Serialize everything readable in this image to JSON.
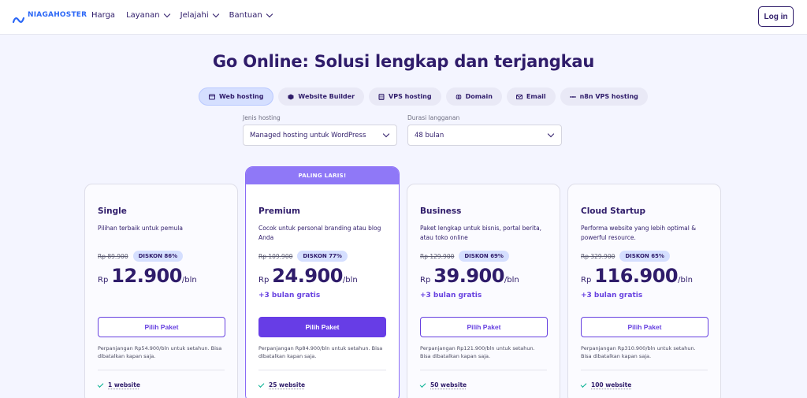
{
  "header": {
    "logo_text": "NIAGAHOSTER",
    "nav": [
      {
        "label": "Harga",
        "has_menu": false
      },
      {
        "label": "Layanan",
        "has_menu": true
      },
      {
        "label": "Jelajahi",
        "has_menu": true
      },
      {
        "label": "Bantuan",
        "has_menu": true
      }
    ],
    "login_label": "Log in"
  },
  "headline": "Go Online: Solusi lengkap dan terjangkau",
  "tabs": [
    {
      "label": "Web hosting",
      "icon": "window-icon",
      "active": true
    },
    {
      "label": "Website Builder",
      "icon": "cube-icon",
      "active": false
    },
    {
      "label": "VPS hosting",
      "icon": "server-icon",
      "active": false
    },
    {
      "label": "Domain",
      "icon": "globe-icon",
      "active": false
    },
    {
      "label": "Email",
      "icon": "mail-icon",
      "active": false
    },
    {
      "label": "n8n VPS hosting",
      "icon": "workflow-icon",
      "active": false
    }
  ],
  "filters": {
    "hosting_type": {
      "label": "Jenis hosting",
      "value": "Managed hosting untuk WordPress"
    },
    "duration": {
      "label": "Durasi langganan",
      "value": "48 bulan"
    }
  },
  "plans": [
    {
      "name": "Single",
      "description": "Pilihan terbaik untuk pemula",
      "original_price": "Rp 89.900",
      "discount": "DISKON 86%",
      "currency": "Rp",
      "price": "12.900",
      "period": "/bln",
      "bonus": "",
      "button": "Pilih Paket",
      "renewal": "Perpanjangan Rp54.900/bln untuk setahun. Bisa dibatalkan kapan saja.",
      "feature": "1 website",
      "featured": false
    },
    {
      "name": "Premium",
      "ribbon": "PALING LARIS!",
      "description": "Cocok untuk personal branding atau blog Anda",
      "original_price": "Rp 109.900",
      "discount": "DISKON 77%",
      "currency": "Rp",
      "price": "24.900",
      "period": "/bln",
      "bonus": "+3 bulan gratis",
      "button": "Pilih Paket",
      "renewal": "Perpanjangan Rp84.900/bln untuk setahun. Bisa dibatalkan kapan saja.",
      "feature": "25 website",
      "featured": true
    },
    {
      "name": "Business",
      "description": "Paket lengkap untuk bisnis, portal berita, atau toko online",
      "original_price": "Rp 129.900",
      "discount": "DISKON 69%",
      "currency": "Rp",
      "price": "39.900",
      "period": "/bln",
      "bonus": "+3 bulan gratis",
      "button": "Pilih Paket",
      "renewal": "Perpanjangan Rp121.900/bln untuk setahun. Bisa dibatalkan kapan saja.",
      "feature": "50 website",
      "featured": false
    },
    {
      "name": "Cloud Startup",
      "description": "Performa website yang lebih optimal & powerful resource.",
      "original_price": "Rp 329.900",
      "discount": "DISKON 65%",
      "currency": "Rp",
      "price": "116.900",
      "period": "/bln",
      "bonus": "+3 bulan gratis",
      "button": "Pilih Paket",
      "renewal": "Perpanjangan Rp310.900/bln untuk setahun. Bisa dibatalkan kapan saja.",
      "feature": "100 website",
      "featured": false
    }
  ],
  "colors": {
    "brand": "#2b67f6",
    "accent": "#673de6",
    "text": "#2f1c6a",
    "check": "#00b090"
  }
}
